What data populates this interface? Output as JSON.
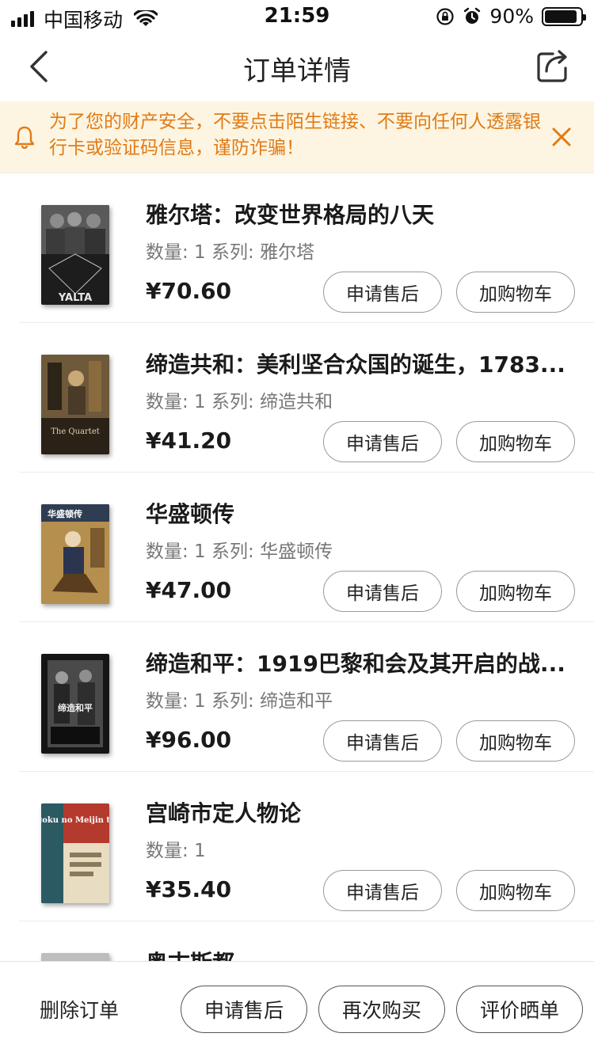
{
  "status_bar": {
    "carrier": "中国移动",
    "time": "21:59",
    "battery": "90%",
    "battery_level": 0.9
  },
  "nav": {
    "title": "订单详情",
    "back_icon": "chevron-left-icon",
    "share_icon": "share-icon"
  },
  "notice": {
    "text": "为了您的财产安全，不要点击陌生链接、不要向任何人透露银行卡或验证码信息，谨防诈骗！",
    "icon": "bell-icon",
    "close_icon": "close-icon",
    "color": "#e07b16",
    "background": "#fdf5e2"
  },
  "items": [
    {
      "title": "雅尔塔：改变世界格局的八天",
      "meta": "数量: 1 系列: 雅尔塔",
      "price": "¥70.60",
      "aftersale_label": "申请售后",
      "cart_label": "加购物车",
      "cover_text": "YALTA"
    },
    {
      "title": "缔造共和：美利坚合众国的诞生，1783...",
      "meta": "数量: 1 系列: 缔造共和",
      "price": "¥41.20",
      "aftersale_label": "申请售后",
      "cart_label": "加购物车",
      "cover_text": "The Quartet"
    },
    {
      "title": "华盛顿传",
      "meta": "数量: 1 系列: 华盛顿传",
      "price": "¥47.00",
      "aftersale_label": "申请售后",
      "cart_label": "加购物车",
      "cover_text": "华盛顿传"
    },
    {
      "title": "缔造和平：1919巴黎和会及其开启的战...",
      "meta": "数量: 1 系列: 缔造和平",
      "price": "¥96.00",
      "aftersale_label": "申请售后",
      "cart_label": "加购物车",
      "cover_text": "缔造和平"
    },
    {
      "title": "宫崎市定人物论",
      "meta": "数量: 1",
      "price": "¥35.40",
      "aftersale_label": "申请售后",
      "cart_label": "加购物车",
      "cover_text": "Chugoku no Meijin to Sais"
    },
    {
      "title": "奥古斯都",
      "meta": "",
      "price": "",
      "aftersale_label": "",
      "cart_label": "",
      "cover_text": ""
    }
  ],
  "bottom_bar": {
    "delete_label": "删除订单",
    "aftersale_label": "申请售后",
    "rebuy_label": "再次购买",
    "review_label": "评价晒单"
  }
}
